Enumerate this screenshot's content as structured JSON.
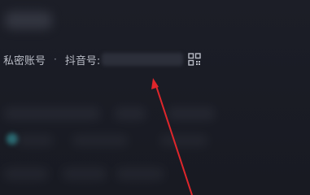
{
  "profile": {
    "private_account_label": "私密账号",
    "separator": "·",
    "douyin_id_label": "抖音号:",
    "douyin_id_value": ""
  },
  "icons": {
    "qr": "qr-code-icon"
  },
  "colors": {
    "background": "#1a1c25",
    "text": "#b9bcc6",
    "annotation_arrow": "#e0262b"
  }
}
